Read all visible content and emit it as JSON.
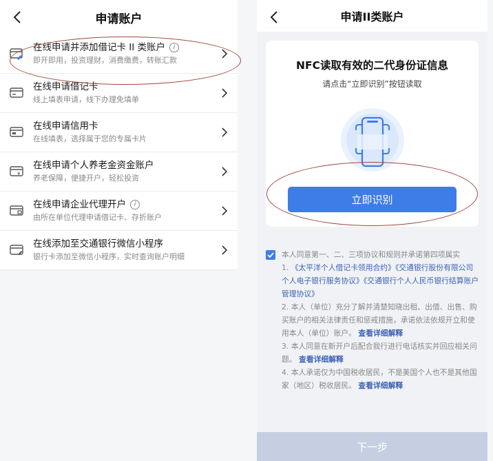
{
  "left": {
    "title": "申请账户",
    "items": [
      {
        "title": "在线申请并添加借记卡 II 类账户",
        "sub": "即开即用，投资理财，消费缴费，转账汇款",
        "icon": "card-edit-icon",
        "info": true
      },
      {
        "title": "在线申请借记卡",
        "sub": "线上填表申请，线下办理免填单",
        "icon": "card-icon",
        "info": false
      },
      {
        "title": "在线申请信用卡",
        "sub": "在线填表，选择属于您的专属卡片",
        "icon": "credit-card-icon",
        "info": false
      },
      {
        "title": "在线申请个人养老金资金账户",
        "sub": "养老保障，便捷开户，轻松投资",
        "icon": "pension-card-icon",
        "info": false
      },
      {
        "title": "在线申请企业代理开户",
        "sub": "由所在单位代理申请借记卡、存折账户",
        "icon": "enterprise-card-icon",
        "info": true
      },
      {
        "title": "在线添加至交通银行微信小程序",
        "sub": "银行卡添加至微信小程序，实时查询账户明细",
        "icon": "wechat-card-icon",
        "info": false
      }
    ],
    "info_glyph": "i"
  },
  "right": {
    "title": "申请II类账户",
    "card_heading": "NFC读取有效的二代身份证信息",
    "card_sub": "请点击“立即识别”按钮读取",
    "primary_button": "立即识别",
    "agree": {
      "intro": "本人同意第一、二、三项协议和规则并承诺第四项属实",
      "p1_prefix": "1. ",
      "p1_links": "《太平洋个人借记卡领用合约》《交通银行股份有限公司个人电子银行服务协议》《交通银行个人人民币银行结算账户管理协议》",
      "p2": "2. 本人（单位）充分了解并清楚知晓出租、出借、出售、购买账户的相关法律责任和惩戒措施，承诺依法依规开立和使用本人（单位）账户。",
      "p3": "3. 本人同意在新开户后配合我行进行电话核实并回应相关问题。",
      "p4": "4. 本人承诺仅为中国税收居民，不是美国个人也不是其他国家（地区）税收居民。",
      "detail_link": "查看详细解释"
    },
    "next_button": "下一步"
  },
  "colors": {
    "primary": "#3e7ce8",
    "link": "#3e63b5",
    "annotation": "#a0463c",
    "disabled": "#c6cfe2"
  }
}
